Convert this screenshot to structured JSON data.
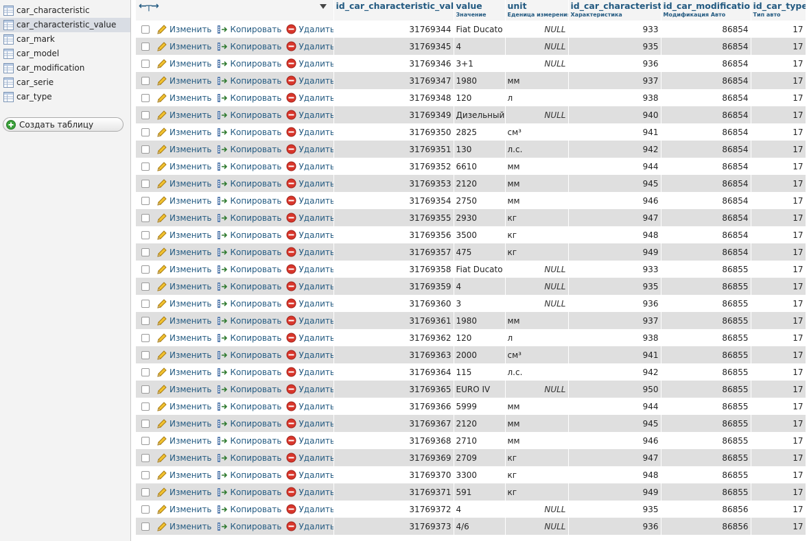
{
  "sidebar": {
    "tables": [
      {
        "name": "car_characteristic",
        "selected": false
      },
      {
        "name": "car_characteristic_value",
        "selected": true
      },
      {
        "name": "car_mark",
        "selected": false
      },
      {
        "name": "car_model",
        "selected": false
      },
      {
        "name": "car_modification",
        "selected": false
      },
      {
        "name": "car_serie",
        "selected": false
      },
      {
        "name": "car_type",
        "selected": false
      }
    ],
    "create_table_label": "Создать таблицу"
  },
  "actions": {
    "edit": "Изменить",
    "copy": "Копировать",
    "delete": "Удалить"
  },
  "columns": [
    {
      "name": "id_car_characteristic_value",
      "comment": ""
    },
    {
      "name": "value",
      "comment": "Значение"
    },
    {
      "name": "unit",
      "comment": "Еденица измерения"
    },
    {
      "name": "id_car_characteristic",
      "comment": "Характеристика"
    },
    {
      "name": "id_car_modification",
      "comment": "Модификация Авто"
    },
    {
      "name": "id_car_type",
      "comment": "Тип авто"
    }
  ],
  "rows": [
    [
      "31769344",
      "Fiat Ducato",
      "NULL",
      "933",
      "86854",
      "17"
    ],
    [
      "31769345",
      "4",
      "NULL",
      "935",
      "86854",
      "17"
    ],
    [
      "31769346",
      "3+1",
      "NULL",
      "936",
      "86854",
      "17"
    ],
    [
      "31769347",
      "1980",
      "мм",
      "937",
      "86854",
      "17"
    ],
    [
      "31769348",
      "120",
      "л",
      "938",
      "86854",
      "17"
    ],
    [
      "31769349",
      "Дизельный",
      "NULL",
      "940",
      "86854",
      "17"
    ],
    [
      "31769350",
      "2825",
      "см³",
      "941",
      "86854",
      "17"
    ],
    [
      "31769351",
      "130",
      "л.с.",
      "942",
      "86854",
      "17"
    ],
    [
      "31769352",
      "6610",
      "мм",
      "944",
      "86854",
      "17"
    ],
    [
      "31769353",
      "2120",
      "мм",
      "945",
      "86854",
      "17"
    ],
    [
      "31769354",
      "2750",
      "мм",
      "946",
      "86854",
      "17"
    ],
    [
      "31769355",
      "2930",
      "кг",
      "947",
      "86854",
      "17"
    ],
    [
      "31769356",
      "3500",
      "кг",
      "948",
      "86854",
      "17"
    ],
    [
      "31769357",
      "475",
      "кг",
      "949",
      "86854",
      "17"
    ],
    [
      "31769358",
      "Fiat Ducato",
      "NULL",
      "933",
      "86855",
      "17"
    ],
    [
      "31769359",
      "4",
      "NULL",
      "935",
      "86855",
      "17"
    ],
    [
      "31769360",
      "3",
      "NULL",
      "936",
      "86855",
      "17"
    ],
    [
      "31769361",
      "1980",
      "мм",
      "937",
      "86855",
      "17"
    ],
    [
      "31769362",
      "120",
      "л",
      "938",
      "86855",
      "17"
    ],
    [
      "31769363",
      "2000",
      "см³",
      "941",
      "86855",
      "17"
    ],
    [
      "31769364",
      "115",
      "л.с.",
      "942",
      "86855",
      "17"
    ],
    [
      "31769365",
      "EURO IV",
      "NULL",
      "950",
      "86855",
      "17"
    ],
    [
      "31769366",
      "5999",
      "мм",
      "944",
      "86855",
      "17"
    ],
    [
      "31769367",
      "2120",
      "мм",
      "945",
      "86855",
      "17"
    ],
    [
      "31769368",
      "2710",
      "мм",
      "946",
      "86855",
      "17"
    ],
    [
      "31769369",
      "2709",
      "кг",
      "947",
      "86855",
      "17"
    ],
    [
      "31769370",
      "3300",
      "кг",
      "948",
      "86855",
      "17"
    ],
    [
      "31769371",
      "591",
      "кг",
      "949",
      "86855",
      "17"
    ],
    [
      "31769372",
      "4",
      "NULL",
      "935",
      "86856",
      "17"
    ],
    [
      "31769373",
      "4/6",
      "NULL",
      "936",
      "86856",
      "17"
    ]
  ],
  "icons": {
    "table": "table-icon",
    "create": "plus-circle-icon",
    "edit": "pencil-icon",
    "copy": "copy-icon",
    "delete": "delete-icon",
    "col_arrows": "column-arrows-icon",
    "sort": "sort-down-icon"
  },
  "colors": {
    "link": "#235a81",
    "row_alt": "#dfdfdf",
    "delete_red": "#d9362b",
    "pencil_yellow": "#f2c230",
    "create_green": "#3aa13a"
  }
}
